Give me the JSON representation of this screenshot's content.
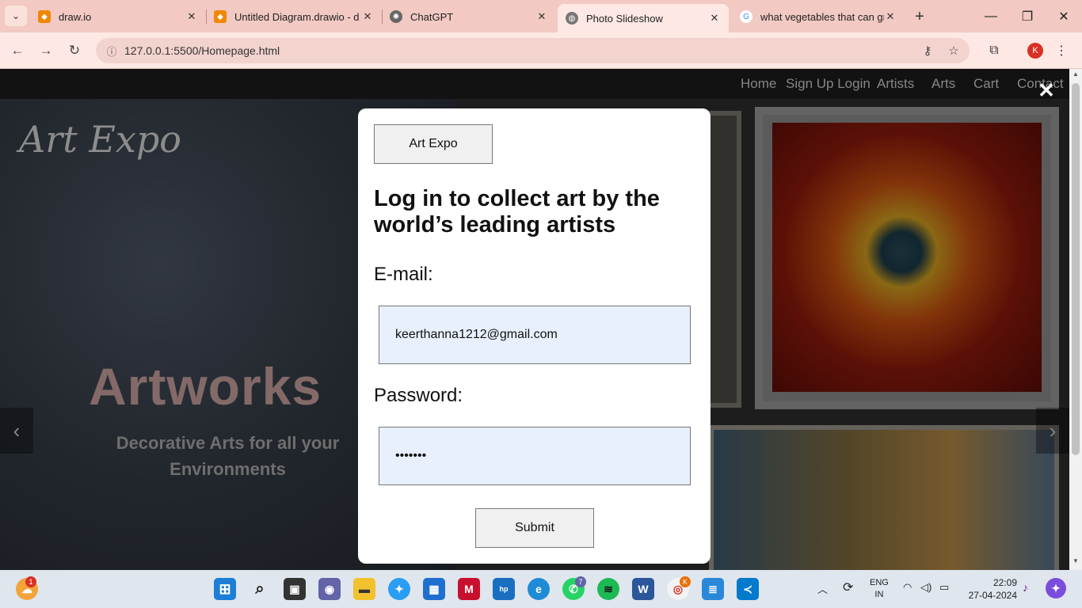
{
  "browser": {
    "tabs": [
      {
        "label": "draw.io",
        "favicon_color": "#f08705"
      },
      {
        "label": "Untitled Diagram.drawio - d",
        "favicon_color": "#f08705"
      },
      {
        "label": "ChatGPT",
        "favicon_color": "#555555"
      },
      {
        "label": "Photo Slideshow",
        "favicon_color": "#555555",
        "active": true
      },
      {
        "label": "what vegetables that can gr",
        "favicon_color": "#4285f4"
      }
    ],
    "url": "127.0.0.1:5500/Homepage.html",
    "profile_initial": "K"
  },
  "site": {
    "nav": [
      "Home",
      "Sign Up Login",
      "Artists",
      "Arts",
      "Cart",
      "Contact"
    ],
    "brand": "Art Expo",
    "hero_title": "Artworks",
    "hero_subtitle": "Decorative Arts for all your Environments",
    "prev_arrow": "‹",
    "next_arrow": "›",
    "close_symbol": "✕"
  },
  "modal": {
    "brand_button": "Art Expo",
    "heading": "Log in to collect art by the world’s leading artists",
    "email_label": "E-mail:",
    "email_value": "keerthanna1212@gmail.com",
    "password_label": "Password:",
    "password_value": "•••••••",
    "submit_label": "Submit"
  },
  "taskbar": {
    "weather_badge": "1",
    "teams_badge": "7",
    "chrome_badge": "K",
    "lang_line1": "ENG",
    "lang_line2": "IN",
    "time": "22:09",
    "date": "27-04-2024"
  }
}
